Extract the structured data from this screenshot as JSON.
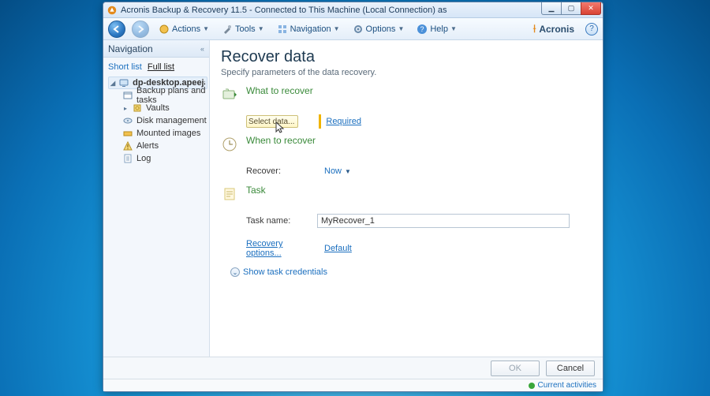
{
  "window": {
    "title": "Acronis Backup & Recovery 11.5 - Connected to This Machine (Local Connection) as"
  },
  "toolbar": {
    "actions": "Actions",
    "tools": "Tools",
    "navigation": "Navigation",
    "options": "Options",
    "help": "Help",
    "brand": "Acronis"
  },
  "sidebar": {
    "header": "Navigation",
    "tabs": {
      "short": "Short list",
      "full": "Full list"
    },
    "root": "dp-desktop.apeejay.stya.com",
    "items": [
      {
        "label": "Backup plans and tasks"
      },
      {
        "label": "Vaults"
      },
      {
        "label": "Disk management"
      },
      {
        "label": "Mounted images"
      },
      {
        "label": "Alerts"
      },
      {
        "label": "Log"
      }
    ]
  },
  "main": {
    "title": "Recover data",
    "subtitle": "Specify parameters of the data recovery.",
    "sections": {
      "what": {
        "title": "What to recover",
        "select_label": "Select data...",
        "required": "Required"
      },
      "when": {
        "title": "When to recover",
        "recover_label": "Recover:",
        "recover_value": "Now"
      },
      "task": {
        "title": "Task",
        "name_label": "Task name:",
        "name_value": "MyRecover_1",
        "options_label": "Recovery options...",
        "options_value": "Default",
        "show_creds": "Show task credentials"
      }
    }
  },
  "footer": {
    "ok": "OK",
    "cancel": "Cancel",
    "status": "Current activities"
  }
}
